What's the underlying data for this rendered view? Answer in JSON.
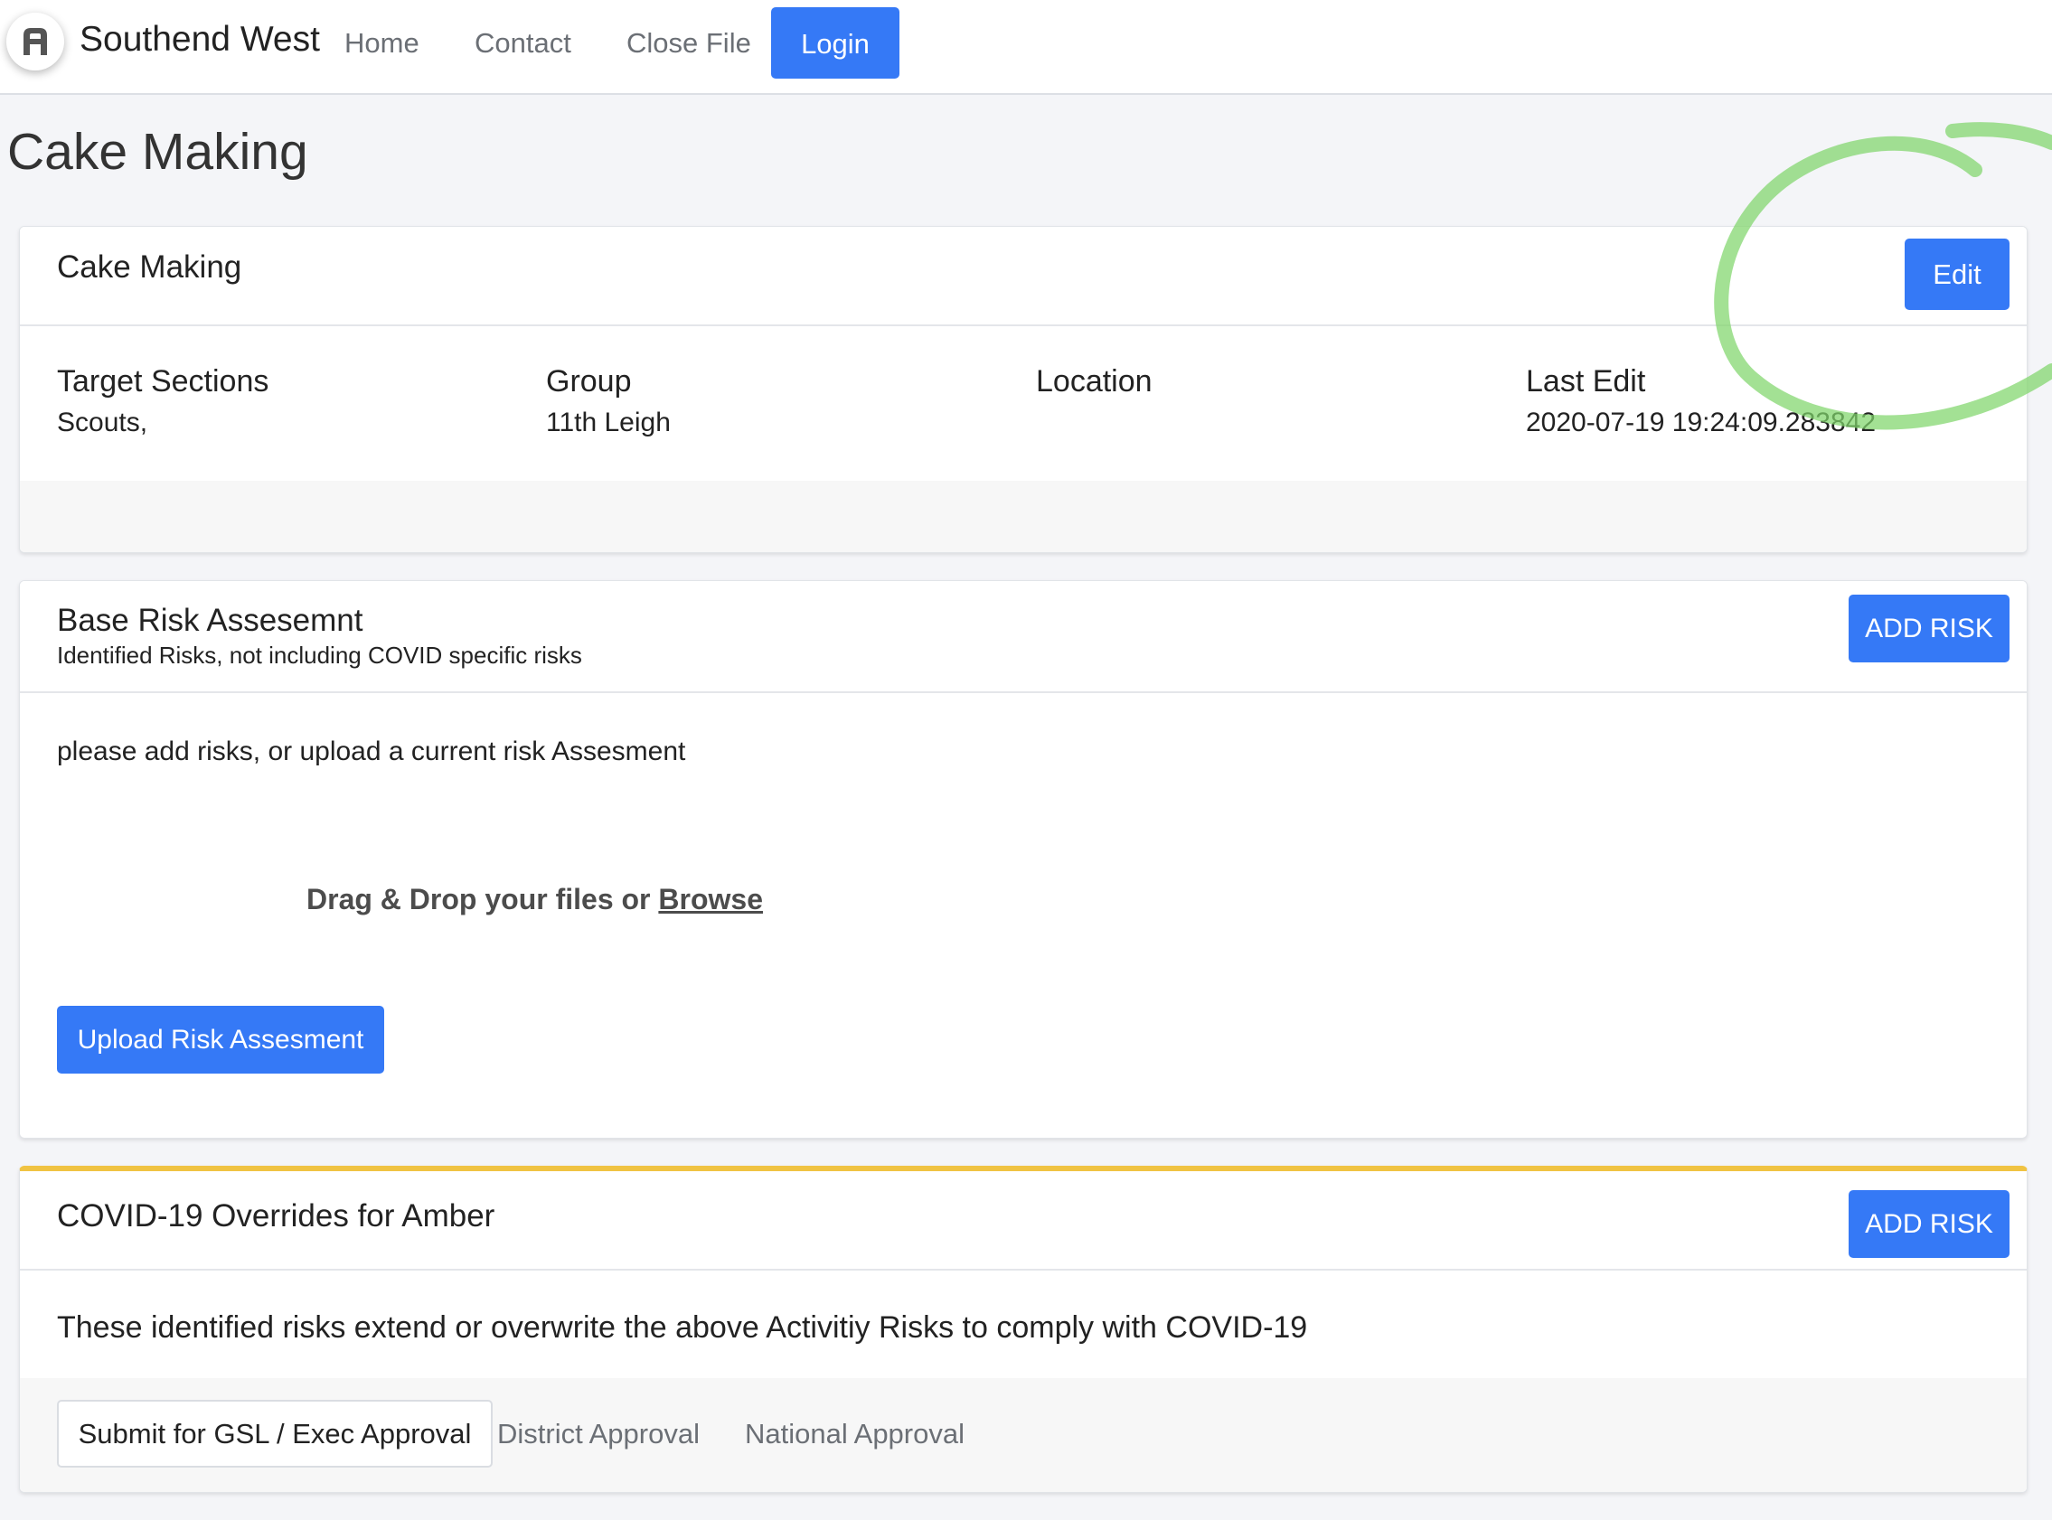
{
  "navbar": {
    "brand": "Southend West",
    "links": [
      "Home",
      "Contact",
      "Close File"
    ],
    "login_label": "Login"
  },
  "page": {
    "title": "Cake Making"
  },
  "activity_card": {
    "title": "Cake Making",
    "edit_label": "Edit",
    "fields": [
      {
        "label": "Target Sections",
        "value": "Scouts,"
      },
      {
        "label": "Group",
        "value": "11th Leigh"
      },
      {
        "label": "Location",
        "value": ""
      },
      {
        "label": "Last Edit",
        "value": "2020-07-19 19:24:09.283842"
      }
    ]
  },
  "base_risk_card": {
    "title": "Base Risk Assesemnt",
    "subtitle": "Identified Risks, not including COVID specific risks",
    "add_risk_label": "ADD RISK",
    "message": "please add risks, or upload a current risk Assesment",
    "dropzone_prefix": "Drag & Drop your files or ",
    "dropzone_link": "Browse",
    "upload_label": "Upload Risk Assesment"
  },
  "covid_card": {
    "title": "COVID-19 Overrides for Amber",
    "add_risk_label": "ADD RISK",
    "message": "These identified risks extend or overwrite the above Activitiy Risks to comply with COVID-19",
    "approval_tabs": [
      "Submit for GSL / Exec Approval",
      "District Approval",
      "National Approval"
    ]
  },
  "colors": {
    "primary": "#3579f6",
    "warning_border": "#f0c343",
    "annotation_green": "#7fd66b"
  },
  "icons": {
    "brand": "app-logo-icon"
  }
}
